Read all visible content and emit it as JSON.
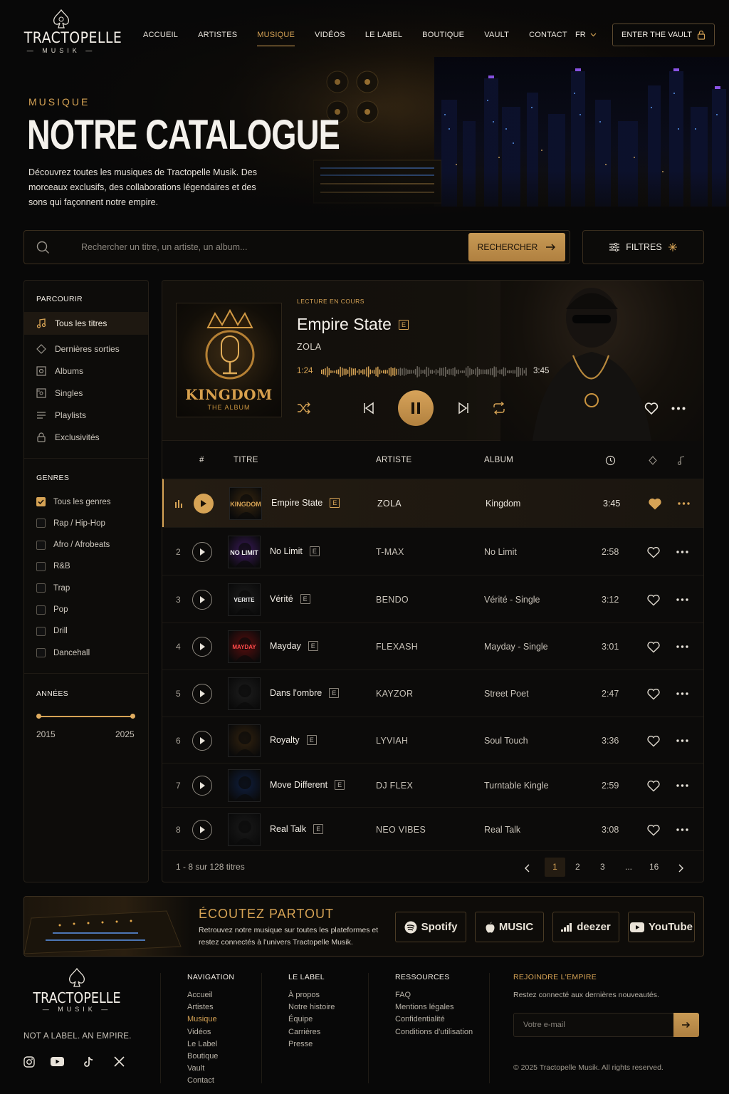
{
  "brand": {
    "name": "TRACTOPELLE",
    "sub": "MUSIK",
    "motto": "NOT A LABEL. AN EMPIRE."
  },
  "nav": {
    "items": [
      "ACCUEIL",
      "ARTISTES",
      "MUSIQUE",
      "VIDÉOS",
      "LE LABEL",
      "BOUTIQUE",
      "VAULT",
      "CONTACT"
    ],
    "active": "MUSIQUE",
    "lang": "FR",
    "vault_button": "ENTER THE VAULT"
  },
  "hero": {
    "kicker": "MUSIQUE",
    "title": "NOTRE CATALOGUE",
    "description": "Découvrez toutes les musiques de Tractopelle Musik. Des morceaux exclusifs, des collaborations légendaires et des sons qui façonnent notre empire."
  },
  "search": {
    "placeholder": "Rechercher un titre, un artiste, un album...",
    "button": "RECHERCHER",
    "filters": "FILTRES"
  },
  "sidebar": {
    "browse_title": "PARCOURIR",
    "browse": [
      {
        "label": "Tous les titres",
        "icon": "music-note-icon",
        "active": true
      },
      {
        "label": "Dernières sorties",
        "icon": "diamond-icon",
        "active": false
      },
      {
        "label": "Albums",
        "icon": "album-icon",
        "active": false
      },
      {
        "label": "Singles",
        "icon": "single-icon",
        "active": false
      },
      {
        "label": "Playlists",
        "icon": "playlist-icon",
        "active": false
      },
      {
        "label": "Exclusivités",
        "icon": "lock-icon",
        "active": false
      }
    ],
    "genres_title": "GENRES",
    "genres": [
      {
        "label": "Tous les genres",
        "checked": true
      },
      {
        "label": "Rap / Hip-Hop",
        "checked": false
      },
      {
        "label": "Afro / Afrobeats",
        "checked": false
      },
      {
        "label": "R&B",
        "checked": false
      },
      {
        "label": "Trap",
        "checked": false
      },
      {
        "label": "Pop",
        "checked": false
      },
      {
        "label": "Drill",
        "checked": false
      },
      {
        "label": "Dancehall",
        "checked": false
      }
    ],
    "years_title": "ANNÉES",
    "year_min": "2015",
    "year_max": "2025"
  },
  "player": {
    "now_label": "LECTURE EN COURS",
    "title": "Empire State",
    "explicit": "E",
    "artist": "ZOLA",
    "elapsed": "1:24",
    "duration": "3:45",
    "progress": 0.37,
    "cover_title": "KINGDOM",
    "cover_sub": "THE ALBUM"
  },
  "table": {
    "headers": {
      "num": "#",
      "title": "TITRE",
      "artist": "ARTISTE",
      "album": "ALBUM"
    },
    "rows": [
      {
        "num": "",
        "title": "Empire State",
        "artist": "ZOLA",
        "album": "Kingdom",
        "duration": "3:45",
        "liked": true,
        "thumb": "KINGDOM",
        "color": "#3a2810"
      },
      {
        "num": "2",
        "title": "No Limit",
        "artist": "T-MAX",
        "album": "No Limit",
        "duration": "2:58",
        "liked": false,
        "thumb": "NO LIMIT",
        "color": "#3b1a5c"
      },
      {
        "num": "3",
        "title": "Vérité",
        "artist": "BENDO",
        "album": "Vérité - Single",
        "duration": "3:12",
        "liked": false,
        "thumb": "VERITE",
        "color": "#1c1c1c"
      },
      {
        "num": "4",
        "title": "Mayday",
        "artist": "FLEXASH",
        "album": "Mayday - Single",
        "duration": "3:01",
        "liked": false,
        "thumb": "MAYDAY",
        "color": "#5a0e0e"
      },
      {
        "num": "5",
        "title": "Dans l'ombre",
        "artist": "KAYZOR",
        "album": "Street Poet",
        "duration": "2:47",
        "liked": false,
        "thumb": "",
        "color": "#1e1e1e"
      },
      {
        "num": "6",
        "title": "Royalty",
        "artist": "LYVIAH",
        "album": "Soul Touch",
        "duration": "3:36",
        "liked": false,
        "thumb": "",
        "color": "#33230f"
      },
      {
        "num": "7",
        "title": "Move Different",
        "artist": "DJ FLEX",
        "album": "Turntable Kingle",
        "duration": "2:59",
        "liked": false,
        "thumb": "",
        "color": "#0f1f40"
      },
      {
        "num": "8",
        "title": "Real Talk",
        "artist": "NEO VIBES",
        "album": "Real Talk",
        "duration": "3:08",
        "liked": false,
        "thumb": "",
        "color": "#1a1a1a"
      }
    ],
    "count_text": "1 - 8 sur 128 titres",
    "pages": [
      "1",
      "2",
      "3",
      "...",
      "16"
    ],
    "current_page": "1"
  },
  "listen": {
    "title": "ÉCOUTEZ PARTOUT",
    "text": "Retrouvez notre musique sur toutes les plateformes et restez connectés à l'univers Tractopelle Musik.",
    "platforms": [
      "Spotify",
      "MUSIC",
      "deezer",
      "YouTube"
    ]
  },
  "footer": {
    "cols": [
      {
        "title": "NAVIGATION",
        "links": [
          "Accueil",
          "Artistes",
          "Musique",
          "Vidéos",
          "Le Label",
          "Boutique",
          "Vault",
          "Contact"
        ],
        "active": "Musique"
      },
      {
        "title": "LE LABEL",
        "links": [
          "À propos",
          "Notre histoire",
          "Équipe",
          "Carrières",
          "Presse"
        ]
      },
      {
        "title": "RESSOURCES",
        "links": [
          "FAQ",
          "Mentions légales",
          "Confidentialité",
          "Conditions d'utilisation"
        ]
      }
    ],
    "news_title": "REJOINDRE L'EMPIRE",
    "news_text": "Restez connecté aux dernières nouveautés.",
    "email_placeholder": "Votre e-mail",
    "copyright": "© 2025 Tractopelle Musik. All rights reserved.",
    "socials": [
      "instagram-icon",
      "youtube-icon",
      "tiktok-icon",
      "x-icon"
    ]
  },
  "colors": {
    "accent": "#d6a355",
    "background": "#080808"
  }
}
